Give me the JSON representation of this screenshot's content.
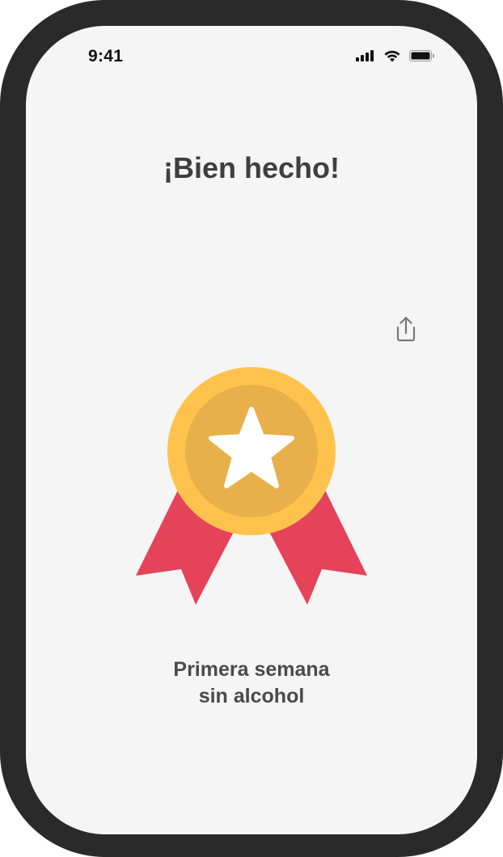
{
  "status_bar": {
    "time": "9:41",
    "icons": [
      "signal-icon",
      "wifi-icon",
      "battery-icon"
    ]
  },
  "screen": {
    "title": "¡Bien hecho!",
    "share_icon": "share-icon",
    "badge_icon": "medal-star-icon",
    "achievement_line1": "Primera semana",
    "achievement_line2": "sin alcohol"
  },
  "colors": {
    "frame": "#2a2a2a",
    "background": "#f5f5f5",
    "medal_outer": "#ffc34d",
    "medal_inner": "#e8b04b",
    "ribbon": "#e5435a",
    "star": "#ffffff",
    "title_text": "#3f3f3f"
  }
}
